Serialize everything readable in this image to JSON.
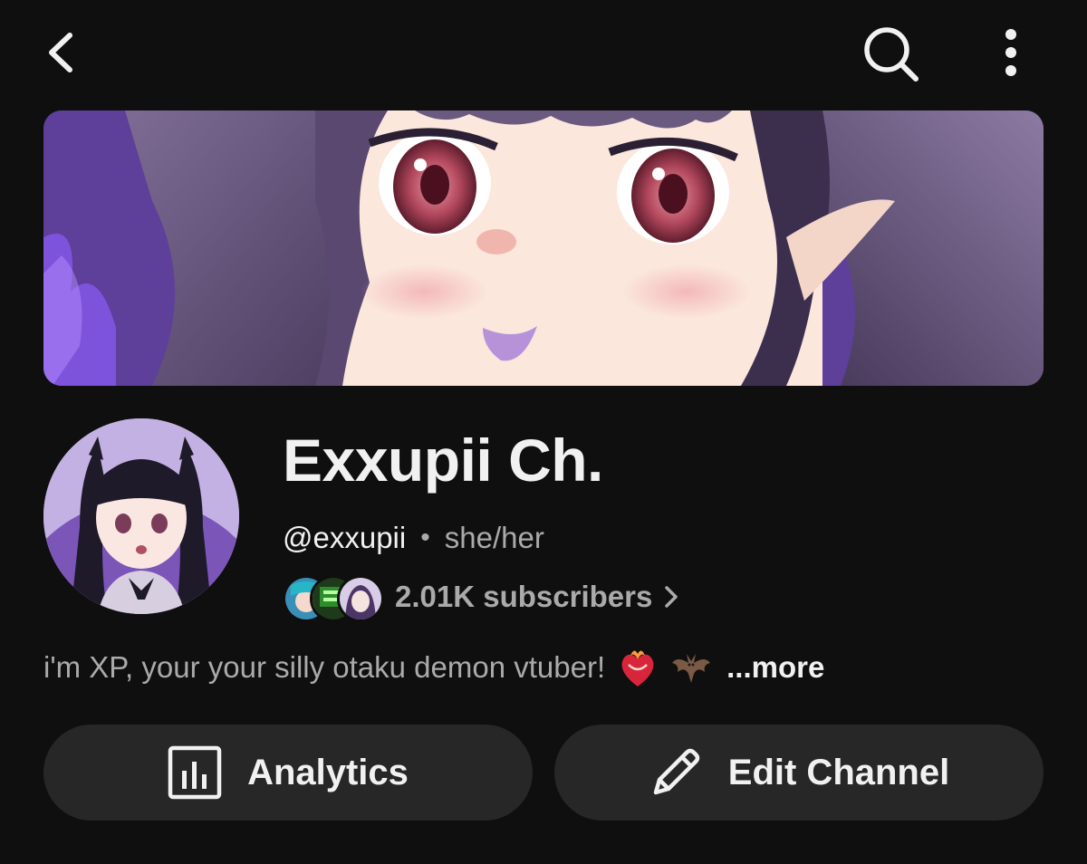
{
  "topbar": {
    "back_icon": "chevron-left-icon",
    "search_icon": "search-icon",
    "more_icon": "more-vertical-icon"
  },
  "banner": {
    "description": "channel-banner-artwork"
  },
  "channel": {
    "name": "Exxupii Ch.",
    "handle": "@exxupii",
    "separator": "•",
    "pronouns": "she/her",
    "subscribers": "2.01K subscribers",
    "description": "i'm XP, your your silly otaku demon vtuber!",
    "more_label": "...more"
  },
  "actions": {
    "analytics_label": "Analytics",
    "edit_label": "Edit Channel"
  },
  "colors": {
    "background": "#0f0f0f",
    "text_primary": "#f1f1f1",
    "text_secondary": "#aaaaaa",
    "button_bg": "#272727"
  }
}
